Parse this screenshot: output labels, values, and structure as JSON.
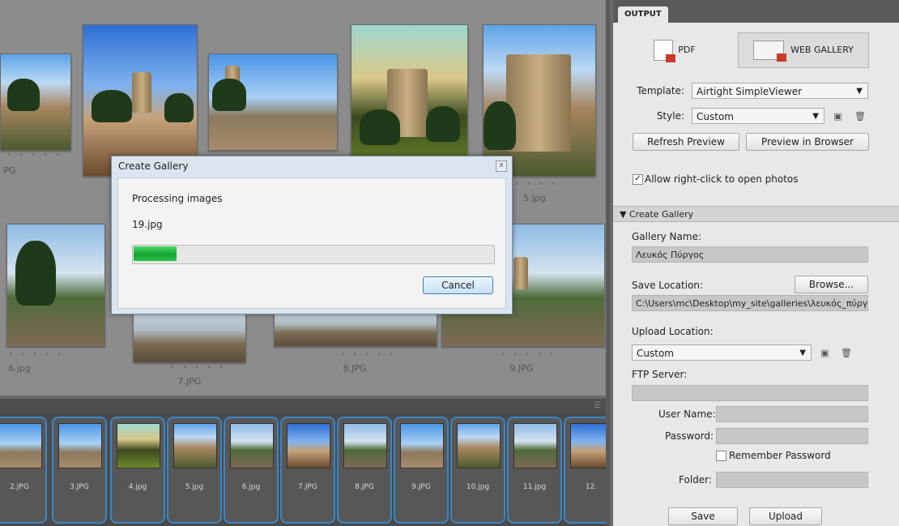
{
  "grid": {
    "labels": [
      "PG",
      "5.jpg",
      "6.jpg",
      "7.JPG",
      "8.JPG",
      "9.JPG"
    ],
    "dots": "• • • • •"
  },
  "filmstrip": {
    "items": [
      "2.JPG",
      "3.JPG",
      "4.jpg",
      "5.jpg",
      "6.jpg",
      "7.JPG",
      "8.JPG",
      "9.JPG",
      "10.jpg",
      "11.jpg",
      "12."
    ]
  },
  "dialog": {
    "title": "Create Gallery",
    "close": "x",
    "status": "Processing images",
    "file": "19.jpg",
    "progress": 0.12,
    "cancel": "Cancel"
  },
  "panel": {
    "tab": "OUTPUT",
    "pdf_label": "PDF",
    "web_label": "WEB GALLERY",
    "template_label": "Template:",
    "template_value": "Airtight SimpleViewer",
    "style_label": "Style:",
    "style_value": "Custom",
    "refresh": "Refresh Preview",
    "preview": "Preview in Browser",
    "allow_right_click": "Allow right-click to open photos",
    "create_gallery_section": "▼ Create Gallery",
    "gallery_name_label": "Gallery Name:",
    "gallery_name_value": "Λευκός Πύργος",
    "save_location_label": "Save Location:",
    "browse": "Browse...",
    "save_location_value": "C:\\Users\\mc\\Desktop\\my_site\\galleries\\λευκός_πύργο",
    "upload_location_label": "Upload Location:",
    "upload_location_value": "Custom",
    "ftp_label": "FTP Server:",
    "user_label": "User Name:",
    "password_label": "Password:",
    "remember": "Remember Password",
    "folder_label": "Folder:",
    "save": "Save",
    "upload": "Upload"
  }
}
